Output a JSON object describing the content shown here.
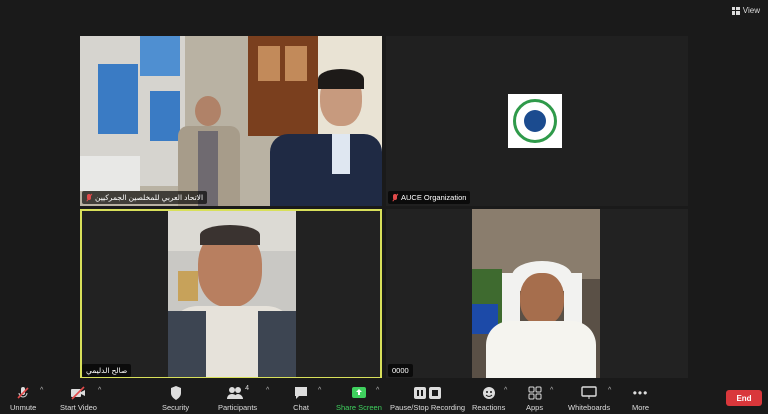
{
  "view_label": "View",
  "participants": [
    {
      "name": "الاتحاد العربي للمخلصين الجمركيين"
    },
    {
      "name": "AUCE Organization"
    },
    {
      "name": "صالح الدليمي"
    },
    {
      "name": "0000"
    }
  ],
  "toolbar": {
    "unmute": "Unmute",
    "start_video": "Start Video",
    "security": "Security",
    "participants": "Participants",
    "participants_count": "4",
    "chat": "Chat",
    "share_screen": "Share Screen",
    "recording": "Pause/Stop Recording",
    "reactions": "Reactions",
    "apps": "Apps",
    "whiteboards": "Whiteboards",
    "more": "More",
    "end": "End"
  },
  "colors": {
    "active_speaker_border": "#d8e05a",
    "end_button": "#d9373b",
    "share_green": "#3fd05e",
    "muted_red": "#e24b4b"
  }
}
